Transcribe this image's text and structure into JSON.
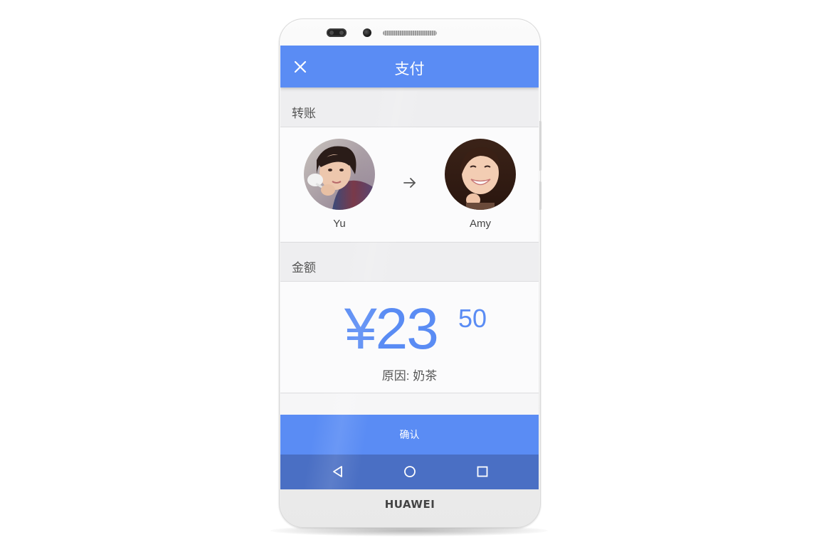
{
  "device": {
    "brand": "HUAWEI"
  },
  "appbar": {
    "title": "支付",
    "close_icon": "close-icon"
  },
  "transfer": {
    "section_label": "转账",
    "from": {
      "name": "Yu",
      "avatar": "avatar-photo"
    },
    "to": {
      "name": "Amy",
      "avatar": "avatar-photo"
    },
    "arrow_icon": "arrow-right-icon"
  },
  "amount": {
    "section_label": "金额",
    "main": "¥23",
    "cents": "50",
    "reason": "原因: 奶茶"
  },
  "confirm": {
    "label": "确认"
  },
  "navbar": {
    "back_icon": "back-triangle-icon",
    "home_icon": "home-circle-icon",
    "recents_icon": "recents-square-icon"
  },
  "colors": {
    "accent": "#5a8cf4",
    "navbar": "#4a6fc4",
    "section_bg": "#eeeef0"
  }
}
